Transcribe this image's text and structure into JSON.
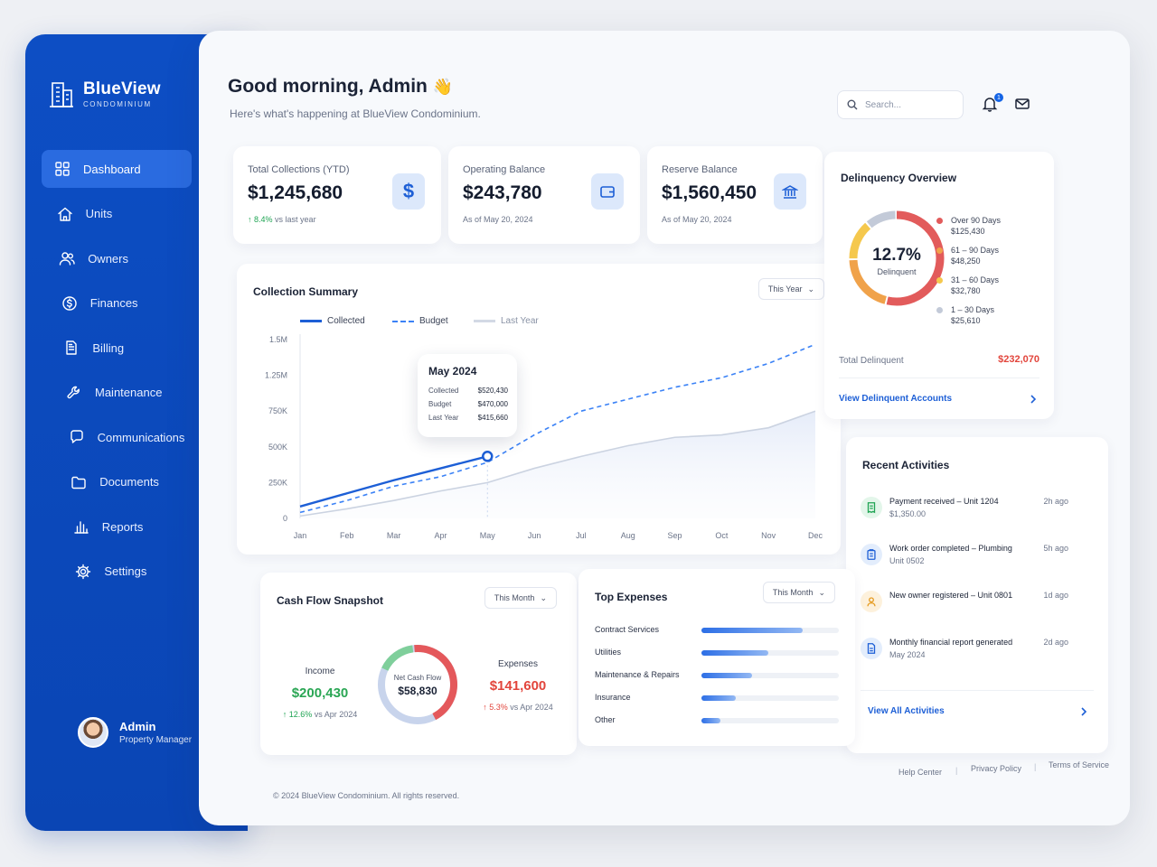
{
  "app": {
    "name": "BlueView",
    "tagline": "CONDOMINIUM"
  },
  "nav": [
    {
      "label": "Dashboard",
      "icon": "grid-icon",
      "active": true
    },
    {
      "label": "Units",
      "icon": "home-icon"
    },
    {
      "label": "Owners",
      "icon": "users-icon"
    },
    {
      "label": "Finances",
      "icon": "dollar-circle-icon"
    },
    {
      "label": "Billing",
      "icon": "document-icon"
    },
    {
      "label": "Maintenance",
      "icon": "wrench-icon"
    },
    {
      "label": "Communications",
      "icon": "chat-icon"
    },
    {
      "label": "Documents",
      "icon": "folder-icon"
    },
    {
      "label": "Reports",
      "icon": "bar-chart-icon"
    },
    {
      "label": "Settings",
      "icon": "gear-icon"
    }
  ],
  "user": {
    "name": "Admin",
    "role": "Property Manager"
  },
  "header": {
    "greeting": "Good morning, Admin",
    "wave": "👋",
    "subtitle": "Here's what's happening at BlueView Condominium.",
    "search_placeholder": "Search...",
    "notification_count": "1"
  },
  "kpis": [
    {
      "label": "Total Collections (YTD)",
      "value": "$1,245,680",
      "change": "8.4%",
      "change_note": "vs last year",
      "icon": "dollar-icon"
    },
    {
      "label": "Operating Balance",
      "value": "$243,780",
      "note": "As of May 20, 2024",
      "icon": "wallet-icon"
    },
    {
      "label": "Reserve Balance",
      "value": "$1,560,450",
      "note": "As of May 20, 2024",
      "icon": "bank-icon"
    }
  ],
  "collection_summary": {
    "title": "Collection Summary",
    "filter": "This Year",
    "legend": [
      "Collected",
      "Budget",
      "Last Year"
    ],
    "tooltip": {
      "title": "May 2024",
      "rows": [
        [
          "Collected",
          "$520,430"
        ],
        [
          "Budget",
          "$470,000"
        ],
        [
          "Last Year",
          "$415,660"
        ]
      ]
    }
  },
  "chart_data": {
    "type": "line",
    "title": "Collection Summary",
    "categories": [
      "Jan",
      "Feb",
      "Mar",
      "Apr",
      "May",
      "Jun",
      "Jul",
      "Aug",
      "Sep",
      "Oct",
      "Nov",
      "Dec"
    ],
    "y_ticks": [
      "0",
      "250K",
      "500K",
      "750K",
      "1.25M",
      "1.5M"
    ],
    "ylim": [
      0,
      1500000
    ],
    "series": [
      {
        "name": "Collected",
        "values": [
          100000,
          210000,
          320000,
          420000,
          520430
        ],
        "color": "#1d5fd6",
        "style": "solid"
      },
      {
        "name": "Budget",
        "values": [
          50000,
          150000,
          270000,
          350000,
          470000,
          700000,
          900000,
          1000000,
          1100000,
          1180000,
          1300000,
          1460000
        ],
        "color": "#3b82f6",
        "style": "dashed"
      },
      {
        "name": "Last Year",
        "values": [
          20000,
          80000,
          150000,
          230000,
          300000,
          420000,
          520000,
          610000,
          680000,
          700000,
          760000,
          900000
        ],
        "color": "#cbd3e1",
        "style": "solid"
      }
    ],
    "legend_position": "top-left",
    "grid": false
  },
  "delinquency": {
    "title": "Delinquency Overview",
    "center_value": "12.7%",
    "center_label": "Delinquent",
    "buckets": [
      {
        "label": "Over 90 Days",
        "amount": "$125,430",
        "color": "#e25b5b",
        "value": 125430
      },
      {
        "label": "61 – 90 Days",
        "amount": "$48,250",
        "color": "#f0a24a",
        "value": 48250
      },
      {
        "label": "31 – 60 Days",
        "amount": "$32,780",
        "color": "#f5c84d",
        "value": 32780
      },
      {
        "label": "1 – 30 Days",
        "amount": "$25,610",
        "color": "#c3cad8",
        "value": 25610
      }
    ],
    "total_label": "Total Delinquent",
    "total_value": "$232,070",
    "link": "View Delinquent Accounts"
  },
  "activities": {
    "title": "Recent Activities",
    "items": [
      {
        "title": "Payment received – Unit 1204",
        "sub": "$1,350.00",
        "time": "2h ago",
        "icon": "receipt-icon",
        "color": "#1fa453",
        "bg": "#e3f6ea"
      },
      {
        "title": "Work order completed – Plumbing",
        "sub": "Unit 0502",
        "time": "5h ago",
        "icon": "clipboard-icon",
        "color": "#1d5fd6",
        "bg": "#e3edfc"
      },
      {
        "title": "New owner registered – Unit 0801",
        "sub": "",
        "time": "1d ago",
        "icon": "user-icon",
        "color": "#e59a1f",
        "bg": "#fdf1dc"
      },
      {
        "title": "Monthly financial report generated",
        "sub": "May 2024",
        "time": "2d ago",
        "icon": "file-icon",
        "color": "#1d5fd6",
        "bg": "#e3edfc"
      }
    ],
    "link": "View All Activities"
  },
  "cashflow": {
    "title": "Cash Flow Snapshot",
    "filter": "This Month",
    "income_label": "Income",
    "income_value": "$200,430",
    "income_change": "12.6%",
    "income_note": "vs Apr 2024",
    "expenses_label": "Expenses",
    "expenses_value": "$141,600",
    "expenses_change": "5.3%",
    "expenses_note": "vs Apr 2024",
    "center_label": "Net Cash Flow",
    "center_value": "$58,830"
  },
  "top_expenses": {
    "title": "Top Expenses",
    "filter": "This Month",
    "items": [
      {
        "label": "Contract Services",
        "value": 0.74
      },
      {
        "label": "Utilities",
        "value": 0.49
      },
      {
        "label": "Maintenance & Repairs",
        "value": 0.37
      },
      {
        "label": "Insurance",
        "value": 0.25
      },
      {
        "label": "Other",
        "value": 0.14
      }
    ]
  },
  "footer": {
    "copyright": "© 2024 BlueView Condominium. All rights reserved.",
    "links": [
      "Help Center",
      "Privacy Policy",
      "Terms of Service"
    ]
  }
}
